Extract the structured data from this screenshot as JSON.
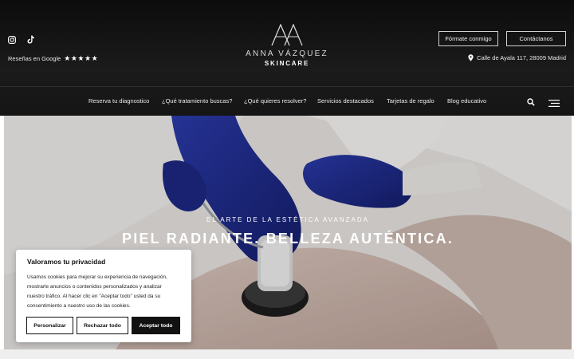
{
  "header": {
    "reviews_label": "Reseñas en Google",
    "reviews_stars": "★★★★★",
    "logo_name": "ANNA VÁZQUEZ",
    "logo_sub": "SKINCARE",
    "btn_format": "Fórmate conmigo",
    "btn_contact": "Contáctanos",
    "address": "Calle de Ayala 117, 28009 Madrid",
    "icons": [
      "instagram-icon",
      "tiktok-icon",
      "location-pin-icon",
      "search-icon",
      "hamburger-menu-icon"
    ]
  },
  "nav": {
    "items": [
      "Reserva tu diagnostico",
      "¿Qué tratamiento buscas?",
      "¿Qué quieres resolver?",
      "Servicios destacados",
      "Tarjetas de regalo",
      "Blog educativo"
    ]
  },
  "hero": {
    "kicker": "EL ARTE DE LA ESTÉTICA AVANZADA",
    "title": "PIEL RADIANTE. BELLEZA AUTÉNTICA."
  },
  "cookie": {
    "title": "Valoramos tu privacidad",
    "text": "Usamos cookies para mejorar su experiencia de navegación, mostrarle anuncios o contenidos personalizados y analizar nuestro tráfico. Al hacer clic en \"Aceptar todo\" usted da su consentimiento a nuestro uso de las cookies.",
    "btn_customize": "Personalizar",
    "btn_reject": "Rechazar todo",
    "btn_accept": "Aceptar todo"
  },
  "colors": {
    "header_bg": "#141414",
    "glove_blue": "#1f2a8c",
    "button_dark": "#111111"
  }
}
